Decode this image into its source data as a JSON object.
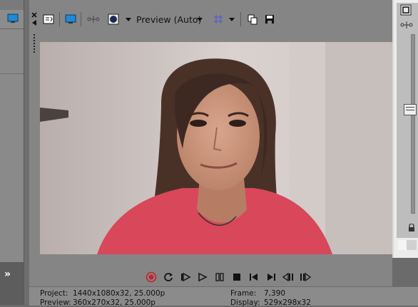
{
  "toolbar": {
    "preview_label": "Preview (Auto)"
  },
  "info": {
    "project_label": "Project:",
    "project_value": "1440x1080x32, 25.000p",
    "preview_label": "Preview:",
    "preview_value": "360x270x32, 25.000p",
    "frame_label": "Frame:",
    "frame_value": "7,390",
    "display_label": "Display:",
    "display_value": "529x298x32"
  },
  "left_panel": {
    "expand_glyph": "»"
  },
  "icons": {
    "record": "record-icon",
    "loop": "loop-icon",
    "play_from_start": "play-from-start-icon",
    "play": "play-icon",
    "pause": "pause-icon",
    "stop": "stop-icon",
    "prev": "previous-marker-icon",
    "next": "next-marker-icon",
    "prev_frame": "previous-frame-icon",
    "next_frame": "next-frame-icon"
  },
  "colors": {
    "record_red": "#c8202a",
    "grid_icon": "#5b5bd6",
    "shirt": "#d8475a"
  }
}
